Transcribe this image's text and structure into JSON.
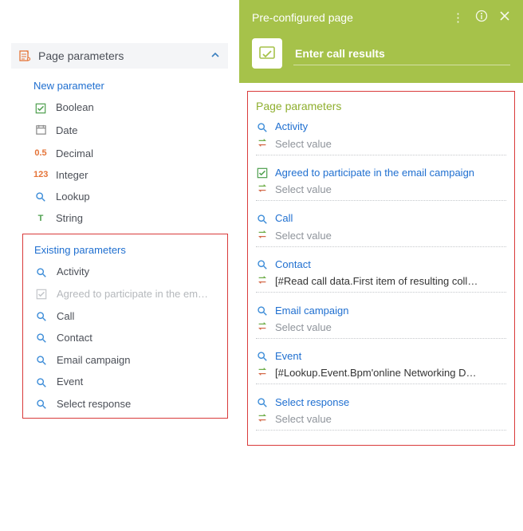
{
  "left": {
    "header": "Page parameters",
    "new_param_link": "New parameter",
    "types": [
      {
        "icon": "checkbox",
        "label": "Boolean"
      },
      {
        "icon": "date",
        "label": "Date"
      },
      {
        "icon": "decimal",
        "label": "Decimal",
        "badge": "0.5"
      },
      {
        "icon": "integer",
        "label": "Integer",
        "badge": "123"
      },
      {
        "icon": "lookup",
        "label": "Lookup"
      },
      {
        "icon": "string",
        "label": "String",
        "badge": "T"
      }
    ],
    "existing_header": "Existing parameters",
    "existing": [
      {
        "icon": "lookup",
        "label": "Activity"
      },
      {
        "icon": "checkbox",
        "label": "Agreed to participate in the em…",
        "disabled": true
      },
      {
        "icon": "lookup",
        "label": "Call"
      },
      {
        "icon": "lookup",
        "label": "Contact"
      },
      {
        "icon": "lookup",
        "label": "Email campaign"
      },
      {
        "icon": "lookup",
        "label": "Event"
      },
      {
        "icon": "lookup",
        "label": "Select response"
      }
    ]
  },
  "right": {
    "header_title": "Pre-configured page",
    "title_value": "Enter call results",
    "section_title": "Page parameters",
    "select_placeholder": "Select value",
    "fields": [
      {
        "icon": "lookup",
        "label": "Activity",
        "value": "",
        "has_value": false
      },
      {
        "icon": "checkbox",
        "label": "Agreed to participate in the email campaign",
        "value": "",
        "has_value": false
      },
      {
        "icon": "lookup",
        "label": "Call",
        "value": "",
        "has_value": false
      },
      {
        "icon": "lookup",
        "label": "Contact",
        "value": "[#Read call data.First item of resulting coll…",
        "has_value": true
      },
      {
        "icon": "lookup",
        "label": "Email campaign",
        "value": "",
        "has_value": false
      },
      {
        "icon": "lookup",
        "label": "Event",
        "value": "[#Lookup.Event.Bpm'online Networking D…",
        "has_value": true
      },
      {
        "icon": "lookup",
        "label": "Select response",
        "value": "",
        "has_value": false
      }
    ]
  }
}
